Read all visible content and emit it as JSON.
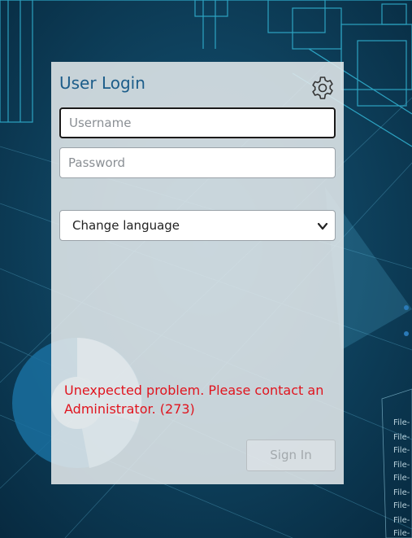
{
  "login": {
    "title": "User Login",
    "username_placeholder": "Username",
    "password_placeholder": "Password",
    "language_select_label": "Change language",
    "error_message": "Unexpected problem. Please contact an Administrator. (273)",
    "signin_label": "Sign In"
  },
  "colors": {
    "title": "#1c5d8a",
    "error": "#e0141e",
    "background": "#0a3550"
  },
  "icons": {
    "settings": "gear-icon",
    "dropdown": "chevron-down-icon"
  }
}
